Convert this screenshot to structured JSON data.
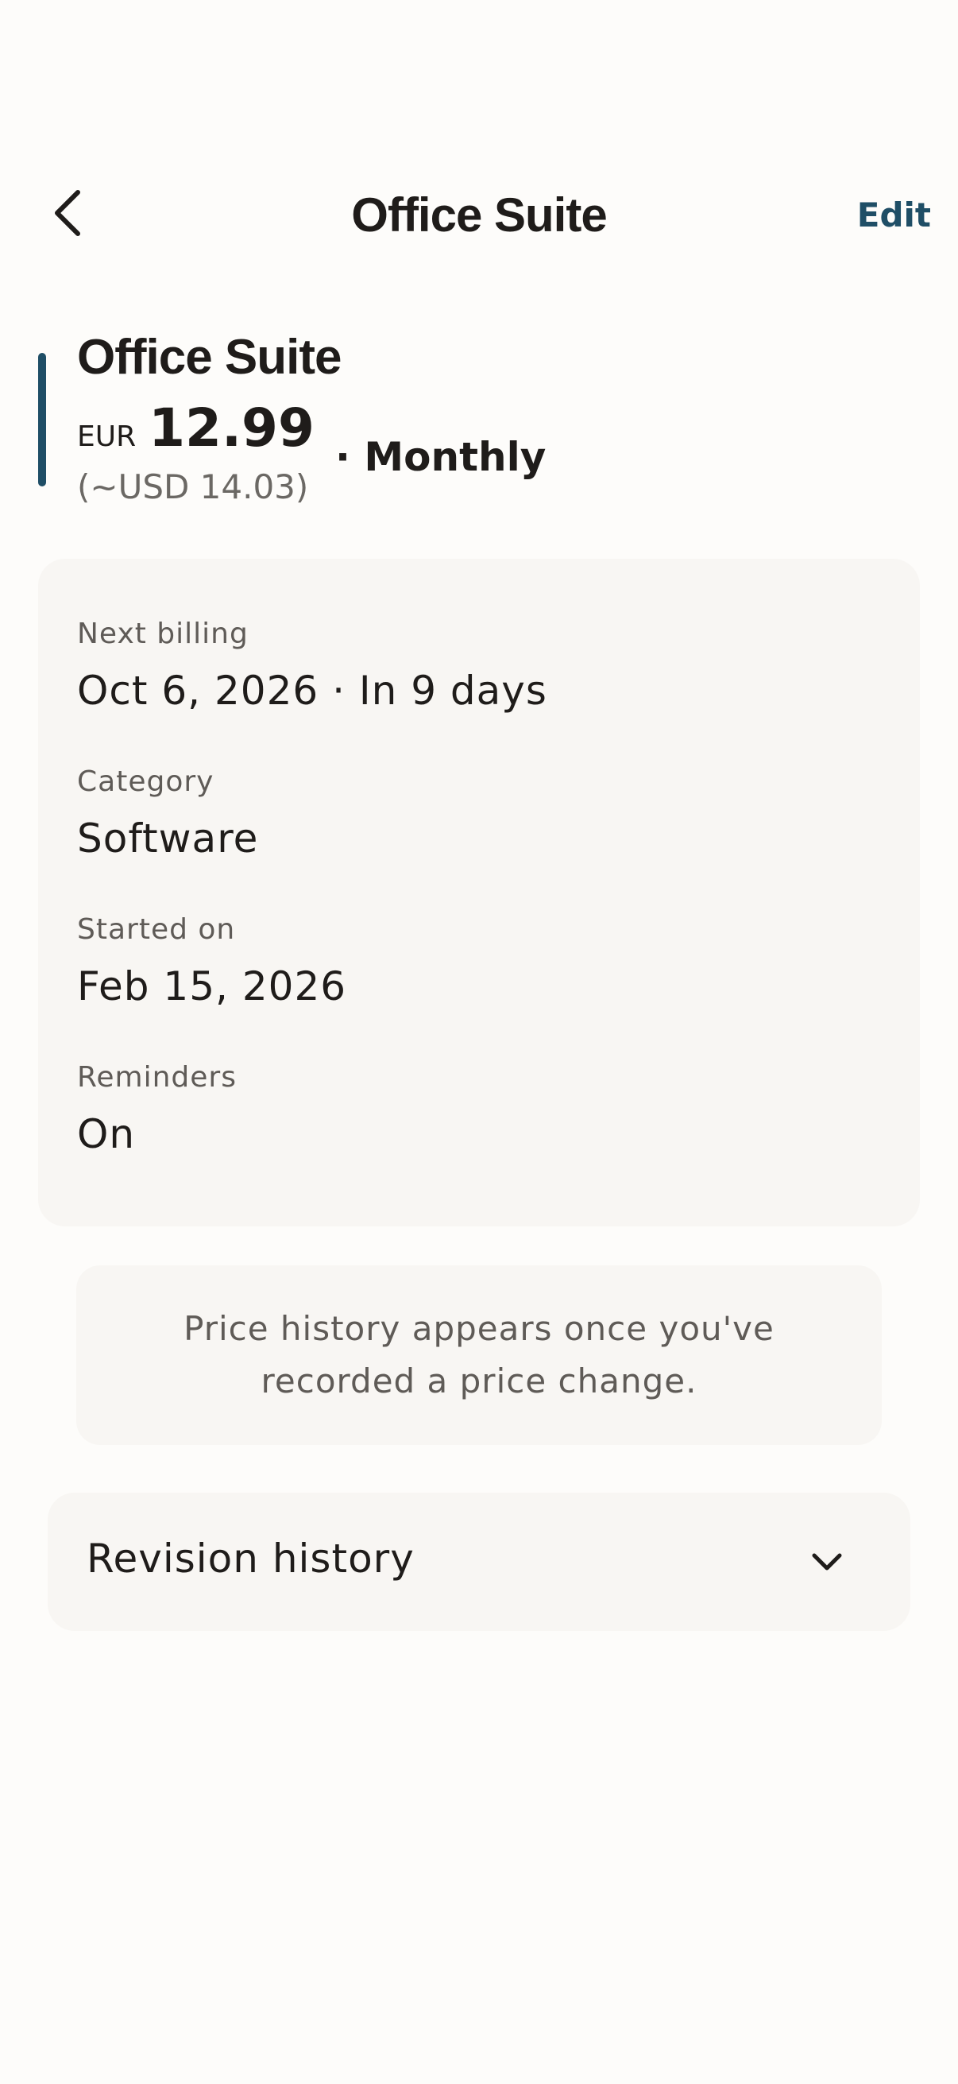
{
  "header": {
    "title": "Office Suite",
    "back_icon": "chevron-left-icon",
    "edit_label": "Edit"
  },
  "summary": {
    "name": "Office Suite",
    "currency": "EUR",
    "amount": "12.99",
    "converted": "(~USD 14.03)",
    "cycle": "· Monthly",
    "accent_color": "#1f4e66"
  },
  "details": {
    "next_billing_label": "Next billing",
    "next_billing_value": "Oct 6, 2026 · In 9 days",
    "category_label": "Category",
    "category_value": "Software",
    "started_label": "Started on",
    "started_value": "Feb 15, 2026",
    "reminders_label": "Reminders",
    "reminders_value": "On"
  },
  "price_history": {
    "empty_message": "Price history appears once you've recorded a price change."
  },
  "revision_history": {
    "label": "Revision history",
    "icon": "chevron-down-icon"
  }
}
